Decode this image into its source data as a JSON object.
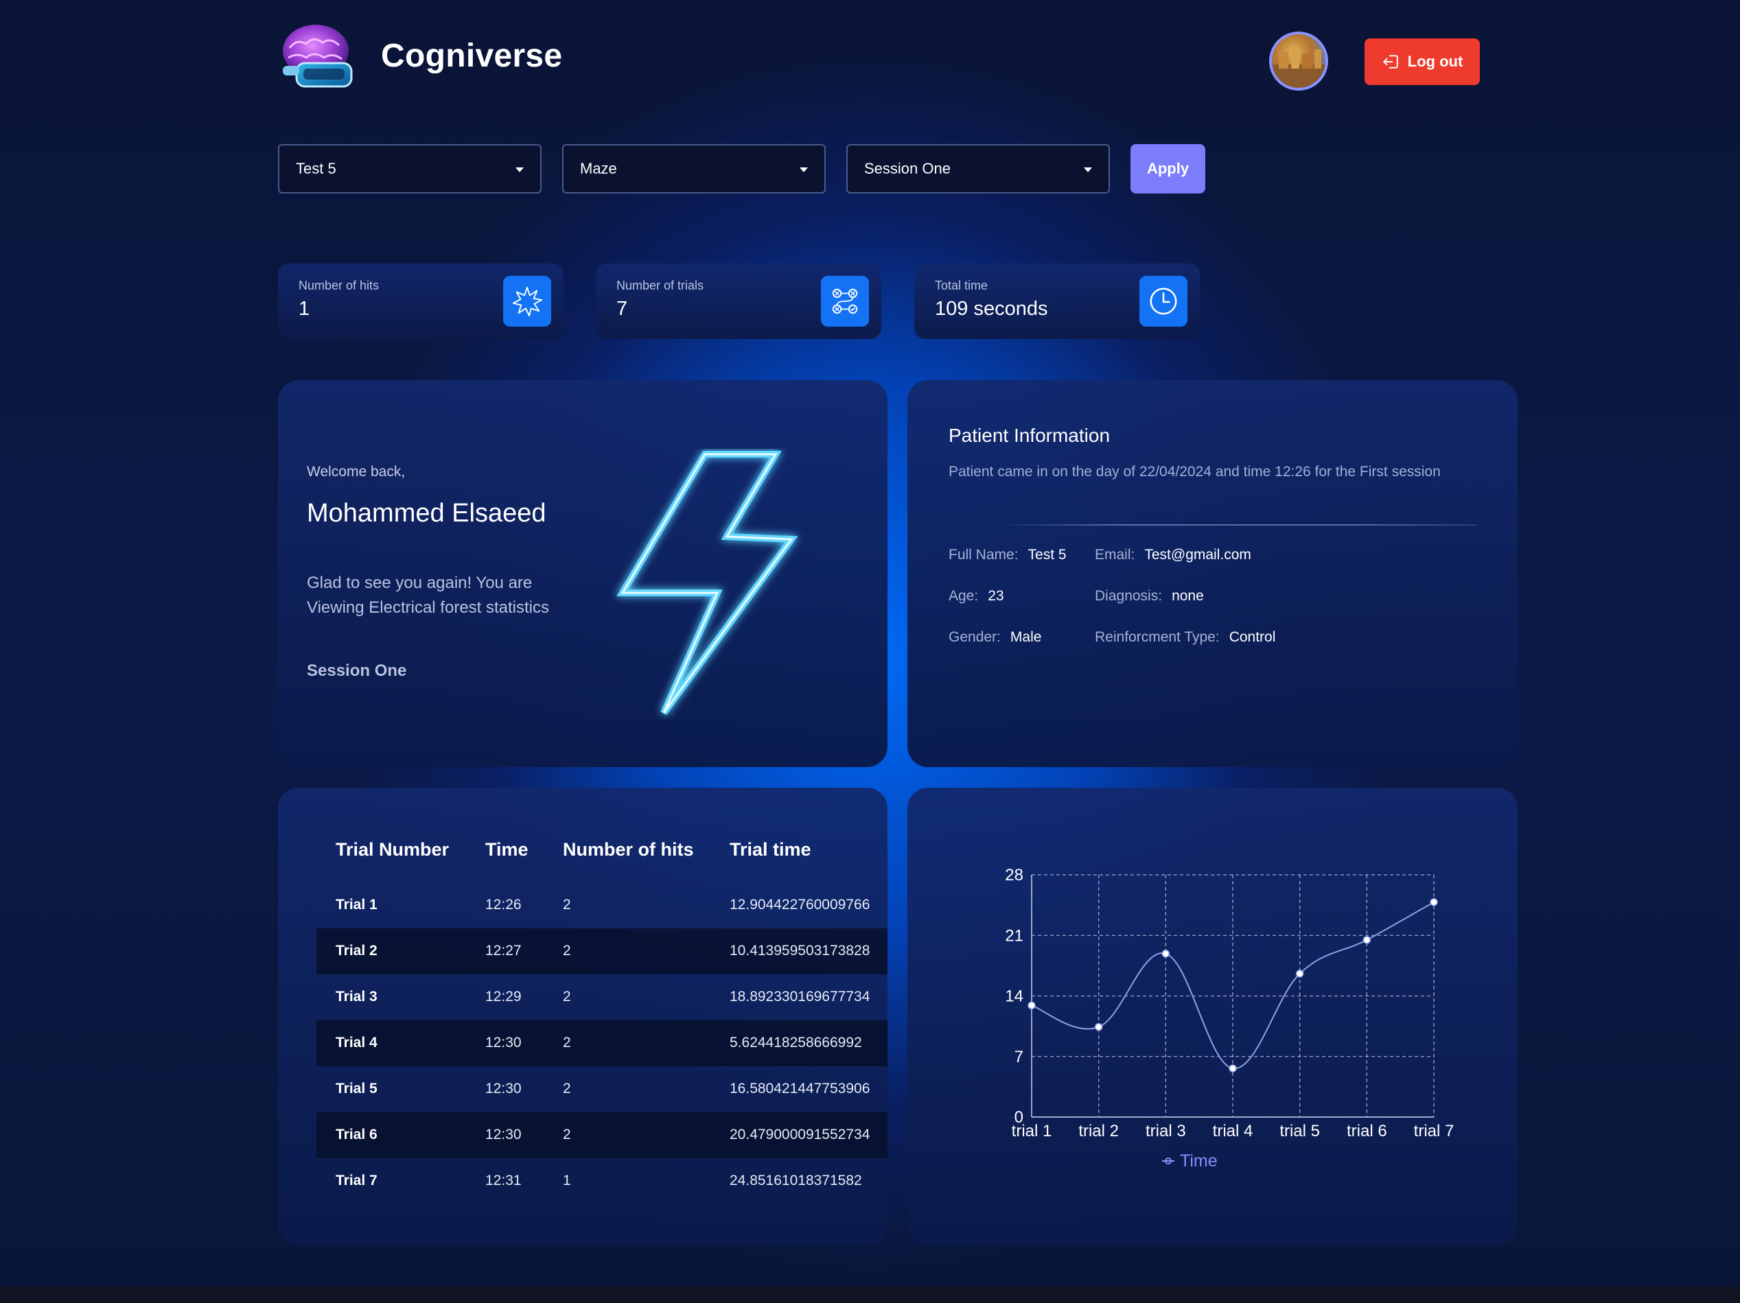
{
  "header": {
    "brand": "Cogniverse",
    "logout_label": "Log out"
  },
  "filters": {
    "test": "Test 5",
    "game": "Maze",
    "session": "Session One",
    "apply_label": "Apply"
  },
  "stats": [
    {
      "label": "Number of hits",
      "value": "1",
      "icon": "burst-icon"
    },
    {
      "label": "Number of trials",
      "value": "7",
      "icon": "trials-flow-icon"
    },
    {
      "label": "Total time",
      "value": "109 seconds",
      "icon": "clock-icon"
    }
  ],
  "welcome": {
    "greeting": "Welcome back,",
    "name": "Mohammed Elsaeed",
    "message": "Glad to see you again! You are Viewing Electrical forest statistics",
    "session": "Session One"
  },
  "patient": {
    "title": "Patient Information",
    "description": "Patient came in on the day of 22/04/2024 and time 12:26 for the First session",
    "fields": {
      "full_name_label": "Full Name:",
      "full_name": "Test 5",
      "email_label": "Email:",
      "email": "Test@gmail.com",
      "age_label": "Age:",
      "age": "23",
      "diagnosis_label": "Diagnosis:",
      "diagnosis": "none",
      "gender_label": "Gender:",
      "gender": "Male",
      "reinforcement_label": "Reinforcment Type:",
      "reinforcement": "Control"
    }
  },
  "table": {
    "headers": [
      "Trial Number",
      "Time",
      "Number of hits",
      "Trial time"
    ],
    "rows": [
      [
        "Trial 1",
        "12:26",
        "2",
        "12.904422760009766"
      ],
      [
        "Trial 2",
        "12:27",
        "2",
        "10.413959503173828"
      ],
      [
        "Trial 3",
        "12:29",
        "2",
        "18.892330169677734"
      ],
      [
        "Trial 4",
        "12:30",
        "2",
        "5.624418258666992"
      ],
      [
        "Trial 5",
        "12:30",
        "2",
        "16.580421447753906"
      ],
      [
        "Trial 6",
        "12:30",
        "2",
        "20.479000091552734"
      ],
      [
        "Trial 7",
        "12:31",
        "1",
        "24.85161018371582"
      ]
    ]
  },
  "chart_data": {
    "type": "line",
    "categories": [
      "trial 1",
      "trial 2",
      "trial 3",
      "trial 4",
      "trial 5",
      "trial 6",
      "trial 7"
    ],
    "series": [
      {
        "name": "Time",
        "values": [
          12.904422760009766,
          10.413959503173828,
          18.892330169677734,
          5.624418258666992,
          16.580421447753906,
          20.479000091552734,
          24.85161018371582
        ]
      }
    ],
    "yticks": [
      "0",
      "7",
      "14",
      "21",
      "28"
    ],
    "ylim": [
      0,
      28
    ],
    "grid": true,
    "legend": "bottom",
    "colors": {
      "line": "#8fa0e8",
      "grid": "#c9d3ee",
      "legend": "#8c8cff"
    }
  }
}
